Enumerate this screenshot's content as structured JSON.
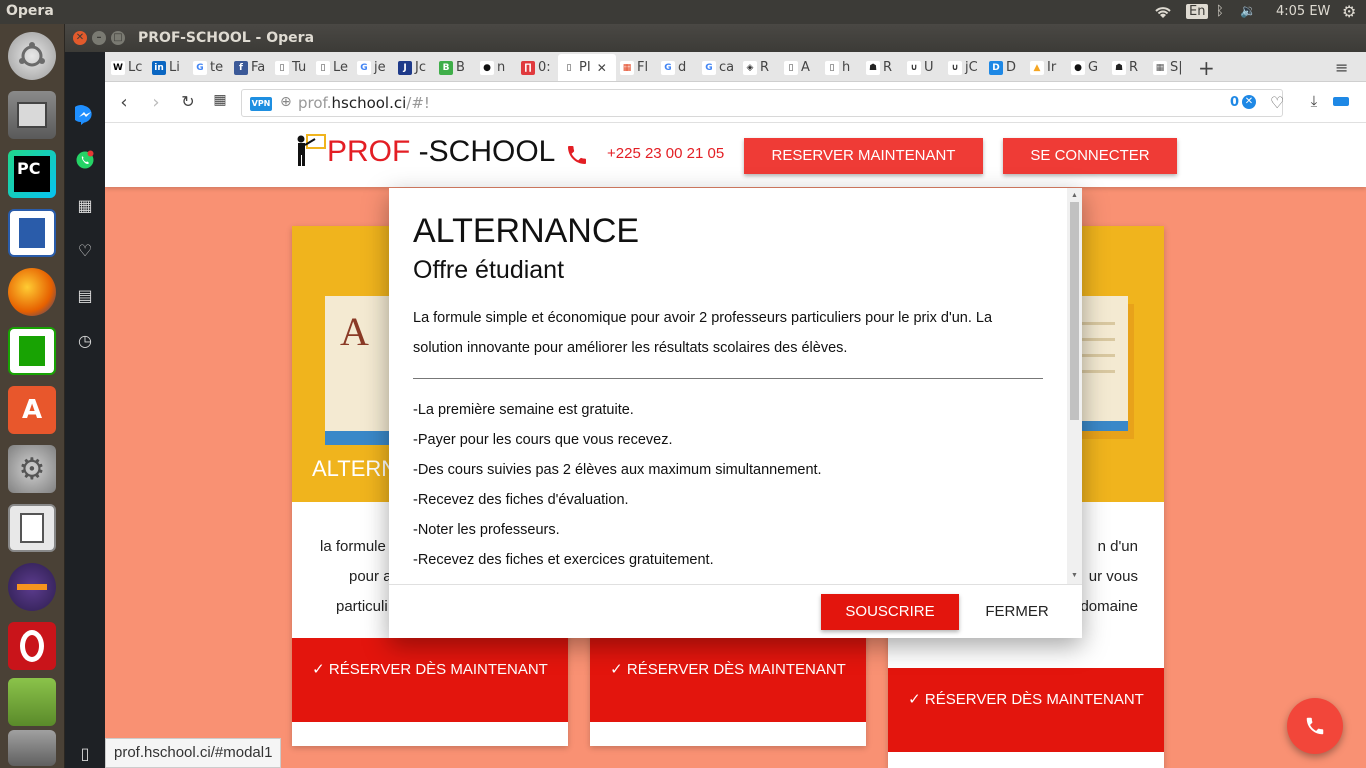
{
  "top_panel": {
    "app_name": "Opera",
    "lang": "En",
    "clock": "4:05 EW"
  },
  "launcher": {
    "items": [
      {
        "name": "ubuntu-dash",
        "glyph": ""
      },
      {
        "name": "files",
        "glyph": ""
      },
      {
        "name": "pycharm",
        "glyph": "PC"
      },
      {
        "name": "writer",
        "glyph": ""
      },
      {
        "name": "firefox",
        "glyph": ""
      },
      {
        "name": "calc",
        "glyph": ""
      },
      {
        "name": "software-center",
        "glyph": "A"
      },
      {
        "name": "settings",
        "glyph": ""
      },
      {
        "name": "libreoffice",
        "glyph": ""
      },
      {
        "name": "eclipse",
        "glyph": ""
      },
      {
        "name": "opera",
        "glyph": ""
      }
    ]
  },
  "window": {
    "title": "PROF-SCHOOL - Opera"
  },
  "tabs": [
    {
      "fav": "W",
      "label": "Lc",
      "color": "#ffffff",
      "fg": "#000"
    },
    {
      "fav": "in",
      "label": "Li",
      "color": "#0a66c2",
      "fg": "#fff"
    },
    {
      "fav": "G",
      "label": "te",
      "color": "#ffffff",
      "fg": "#4285f4"
    },
    {
      "fav": "f",
      "label": "Fa",
      "color": "#3b5998",
      "fg": "#fff"
    },
    {
      "fav": "▯",
      "label": "Tu",
      "color": "#ffffff",
      "fg": "#444"
    },
    {
      "fav": "▯",
      "label": "Le",
      "color": "#ffffff",
      "fg": "#444"
    },
    {
      "fav": "G",
      "label": "je",
      "color": "#ffffff",
      "fg": "#4285f4"
    },
    {
      "fav": "J",
      "label": "Jc",
      "color": "#1e3a8a",
      "fg": "#fff"
    },
    {
      "fav": "B",
      "label": "B",
      "color": "#3fae49",
      "fg": "#fff"
    },
    {
      "fav": "●",
      "label": "n",
      "color": "#ffffff",
      "fg": "#111"
    },
    {
      "fav": "∏",
      "label": "0:",
      "color": "#e03a3e",
      "fg": "#fff"
    },
    {
      "fav": "▯",
      "label": "PI",
      "color": "#ffffff",
      "fg": "#444",
      "active": true
    },
    {
      "fav": "▦",
      "label": "Fl",
      "color": "#ffffff",
      "fg": "#e2401c"
    },
    {
      "fav": "G",
      "label": "d",
      "color": "#ffffff",
      "fg": "#4285f4"
    },
    {
      "fav": "G",
      "label": "ca",
      "color": "#ffffff",
      "fg": "#4285f4"
    },
    {
      "fav": "◈",
      "label": "R",
      "color": "#ffffff",
      "fg": "#333"
    },
    {
      "fav": "▯",
      "label": "A",
      "color": "#ffffff",
      "fg": "#444"
    },
    {
      "fav": "▯",
      "label": "h",
      "color": "#ffffff",
      "fg": "#444"
    },
    {
      "fav": "☗",
      "label": "R",
      "color": "#ffffff",
      "fg": "#222"
    },
    {
      "fav": "∪",
      "label": "U",
      "color": "#ffffff",
      "fg": "#333"
    },
    {
      "fav": "∪",
      "label": "jC",
      "color": "#ffffff",
      "fg": "#333"
    },
    {
      "fav": "D",
      "label": "D",
      "color": "#1e88e5",
      "fg": "#fff"
    },
    {
      "fav": "▲",
      "label": "Ir",
      "color": "#ffffff",
      "fg": "#f5a623"
    },
    {
      "fav": "●",
      "label": "G",
      "color": "#ffffff",
      "fg": "#111"
    },
    {
      "fav": "☗",
      "label": "R",
      "color": "#ffffff",
      "fg": "#222"
    },
    {
      "fav": "▦",
      "label": "S|",
      "color": "#ffffff",
      "fg": "#555"
    }
  ],
  "address": {
    "vpn": "VPN",
    "url_prefix": "prof.",
    "url_domain": "hschool.ci",
    "url_suffix": "/#!",
    "blocked_count": "0"
  },
  "site": {
    "logo_prof": "PROF",
    "logo_school": " -SCHOOL",
    "phone": "+225 23 00 21 05",
    "reserve_btn": "RESERVER MAINTENANT",
    "login_btn": "SE CONNECTER"
  },
  "cards": [
    {
      "title": "ALTERN",
      "line1": "la formule",
      "line2": "pour a",
      "line3": "particuli",
      "button": "RÉSERVER DÈS MAINTENANT"
    },
    {
      "title": "",
      "line1": "",
      "line2": "",
      "line3": "",
      "button": "RÉSERVER DÈS MAINTENANT"
    },
    {
      "title": "",
      "line1": "n d'un",
      "line2": "ur vous",
      "line3": "domaine",
      "button": "RÉSERVER DÈS MAINTENANT"
    }
  ],
  "modal": {
    "title": "ALTERNANCE",
    "subtitle": "Offre étudiant",
    "intro_1": "La formule simple et économique pour avoir 2 professeurs particuliers pour le prix d'un. La",
    "intro_2": "solution innovante pour améliorer les résultats scolaires des élèves.",
    "features": [
      "-La première semaine est gratuite.",
      "-Payer pour les cours que vous recevez.",
      "-Des cours suivies pas 2 élèves aux maximum simultannement.",
      "-Recevez des fiches d'évaluation.",
      "-Noter les professeurs.",
      "-Recevez des fiches et exercices gratuitement."
    ],
    "subscribe_btn": "SOUSCRIRE",
    "close_btn": "FERMER"
  },
  "status_url": "prof.hschool.ci/#modal1",
  "colors": {
    "page_bg": "#f99173",
    "brand_red": "#e31e24",
    "button_red": "#ef3b36",
    "card_yellow": "#f0b41d"
  }
}
